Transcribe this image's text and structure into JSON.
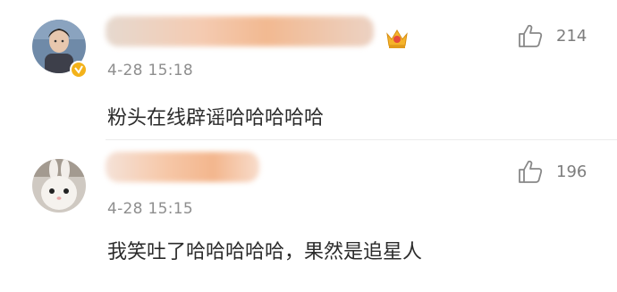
{
  "comments": [
    {
      "time": "4-28 15:18",
      "content": "粉头在线辟谣哈哈哈哈哈",
      "like_count": "214",
      "verified_badge_color": "#f3b21a"
    },
    {
      "time": "4-28 15:15",
      "content": "我笑吐了哈哈哈哈哈，果然是追星人",
      "like_count": "196"
    }
  ],
  "icons": {
    "like": "thumbs-up-icon",
    "vip": "crown-icon",
    "verified": "verified-badge-icon"
  }
}
